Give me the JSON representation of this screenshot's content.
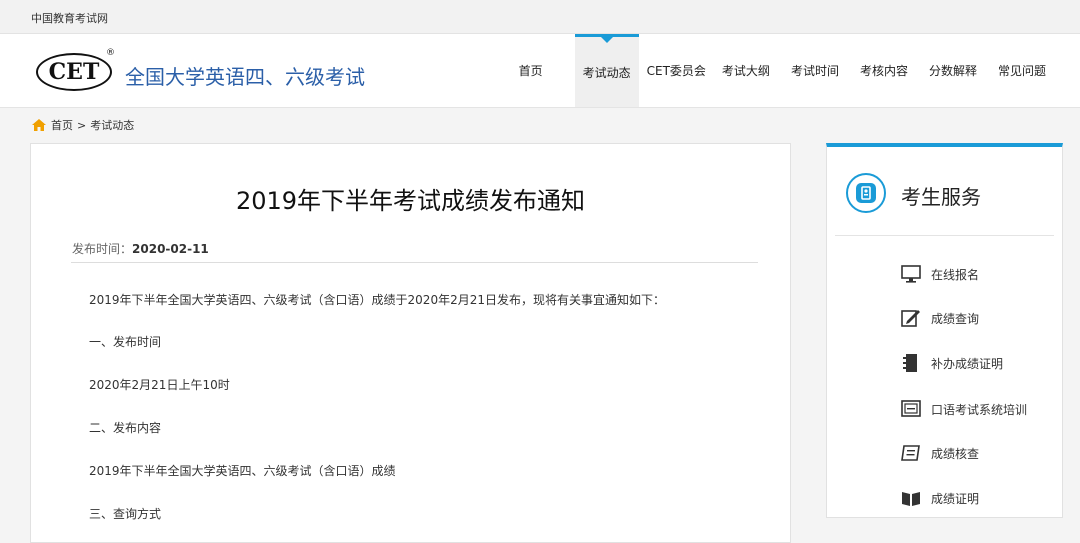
{
  "topbar": {
    "site_name": "中国教育考试网"
  },
  "header": {
    "logo_text": "CET",
    "registered_mark": "®",
    "title": "全国大学英语四、六级考试",
    "nav": [
      {
        "label": "首页"
      },
      {
        "label": "考试动态"
      },
      {
        "label": "CET委员会"
      },
      {
        "label": "考试大纲"
      },
      {
        "label": "考试时间"
      },
      {
        "label": "考核内容"
      },
      {
        "label": "分数解释"
      },
      {
        "label": "常见问题"
      }
    ],
    "active_nav": "考试动态"
  },
  "breadcrumb": {
    "home": "首页",
    "sep": ">",
    "current": "考试动态"
  },
  "article": {
    "title": "2019年下半年考试成绩发布通知",
    "date_label": "发布时间：",
    "date": "2020-02-11",
    "paragraphs": [
      "2019年下半年全国大学英语四、六级考试（含口语）成绩于2020年2月21日发布，现将有关事宜通知如下：",
      "一、发布时间",
      "2020年2月21日上午10时",
      "二、发布内容",
      "2019年下半年全国大学英语四、六级考试（含口语）成绩",
      "三、查询方式"
    ]
  },
  "sidebar": {
    "title": "考生服务",
    "items": [
      {
        "label": "在线报名",
        "icon": "monitor-icon"
      },
      {
        "label": "成绩查询",
        "icon": "edit-icon"
      },
      {
        "label": "补办成绩证明",
        "icon": "notebook-icon"
      },
      {
        "label": "口语考试系统培训",
        "icon": "screen-icon"
      },
      {
        "label": "成绩核查",
        "icon": "document-icon"
      },
      {
        "label": "成绩证明",
        "icon": "book-icon"
      }
    ]
  },
  "colors": {
    "accent": "#1a9bd7",
    "title_blue": "#2b5fa8",
    "home_icon": "#f0a000"
  }
}
